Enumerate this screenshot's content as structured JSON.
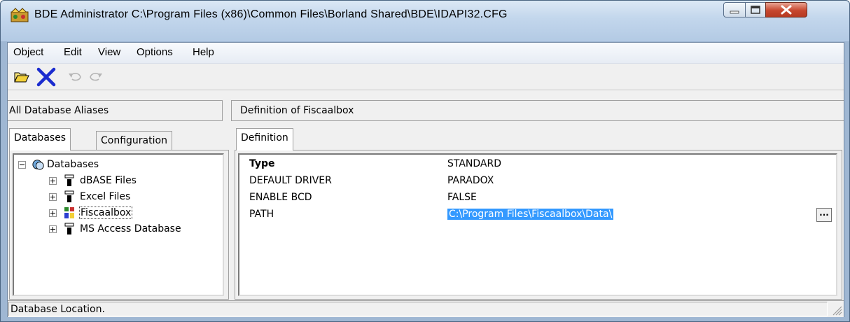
{
  "window": {
    "title": "BDE Administrator  C:\\Program Files (x86)\\Common Files\\Borland Shared\\BDE\\IDAPI32.CFG"
  },
  "menu": {
    "items": [
      "Object",
      "Edit",
      "View",
      "Options",
      "Help"
    ]
  },
  "toolbar": {
    "icons": [
      "open-folder-icon",
      "delete-x-icon",
      "undo-icon",
      "redo-icon"
    ]
  },
  "left_pane": {
    "header": "All Database Aliases",
    "tabs": [
      "Databases",
      "Configuration"
    ],
    "active_tab": "Databases",
    "tree": {
      "root": "Databases",
      "items": [
        "dBASE Files",
        "Excel Files",
        "Fiscaalbox",
        "MS Access Database"
      ],
      "selected": "Fiscaalbox"
    }
  },
  "right_pane": {
    "header": "Definition of Fiscaalbox",
    "tabs": [
      "Definition"
    ],
    "rows": [
      {
        "key": "Type",
        "value": "STANDARD"
      },
      {
        "key": "DEFAULT DRIVER",
        "value": "PARADOX"
      },
      {
        "key": "ENABLE BCD",
        "value": "FALSE"
      },
      {
        "key": "PATH",
        "value": "C:\\Program Files\\Fiscaalbox\\Data\\"
      }
    ],
    "ellipsis_label": "..."
  },
  "status": {
    "text": "Database Location."
  },
  "colors": {
    "selection": "#3399ff",
    "delete_icon": "#1b2ccf",
    "titlebar": "#c2d6ec"
  }
}
